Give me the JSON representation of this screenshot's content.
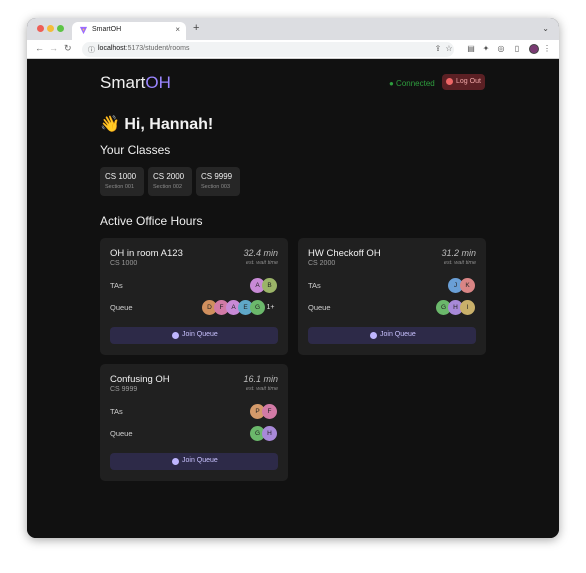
{
  "browser": {
    "tab_title": "SmartOH",
    "tab_close": "×",
    "new_tab": "+",
    "url_host": "localhost",
    "url_path": ":5173/student/rooms"
  },
  "app": {
    "brand_smart": "Smart",
    "brand_oh": "OH",
    "status": "● Connected",
    "logout_label": "Log Out",
    "greeting": "👋 Hi, Hannah!",
    "classes_heading": "Your Classes",
    "active_heading": "Active Office Hours"
  },
  "classes": [
    {
      "code": "CS 1000",
      "section": "Section 001"
    },
    {
      "code": "CS 2000",
      "section": "Section 002"
    },
    {
      "code": "CS 9999",
      "section": "Section 003"
    }
  ],
  "rooms": [
    {
      "title": "OH in room A123",
      "course": "CS 1000",
      "wait": "32.4 min",
      "wait_label": "est. wait time",
      "tas_label": "TAs",
      "queue_label": "Queue",
      "tas": [
        {
          "initial": "A",
          "color": "#c88ad6"
        },
        {
          "initial": "B",
          "color": "#9bb468"
        }
      ],
      "queue": [
        {
          "initial": "D",
          "color": "#d08f5e"
        },
        {
          "initial": "F",
          "color": "#d27aa6"
        },
        {
          "initial": "A",
          "color": "#c88ad6"
        },
        {
          "initial": "E",
          "color": "#5fa8c8"
        },
        {
          "initial": "G",
          "color": "#6bb86b"
        }
      ],
      "queue_more": "1+",
      "join_label": "Join Queue"
    },
    {
      "title": "HW Checkoff OH",
      "course": "CS 2000",
      "wait": "31.2 min",
      "wait_label": "est. wait time",
      "tas_label": "TAs",
      "queue_label": "Queue",
      "tas": [
        {
          "initial": "J",
          "color": "#6a9fd6"
        },
        {
          "initial": "K",
          "color": "#d98585"
        }
      ],
      "queue": [
        {
          "initial": "G",
          "color": "#6bb86b"
        },
        {
          "initial": "H",
          "color": "#a889d8"
        },
        {
          "initial": "I",
          "color": "#c9b06a"
        }
      ],
      "join_label": "Join Queue"
    },
    {
      "title": "Confusing OH",
      "course": "CS 9999",
      "wait": "16.1 min",
      "wait_label": "est. wait time",
      "tas_label": "TAs",
      "queue_label": "Queue",
      "tas": [
        {
          "initial": "P",
          "color": "#d49a6a"
        },
        {
          "initial": "F",
          "color": "#d27aa6"
        }
      ],
      "queue": [
        {
          "initial": "G",
          "color": "#6bb86b"
        },
        {
          "initial": "H",
          "color": "#a889d8"
        }
      ],
      "join_label": "Join Queue"
    }
  ]
}
